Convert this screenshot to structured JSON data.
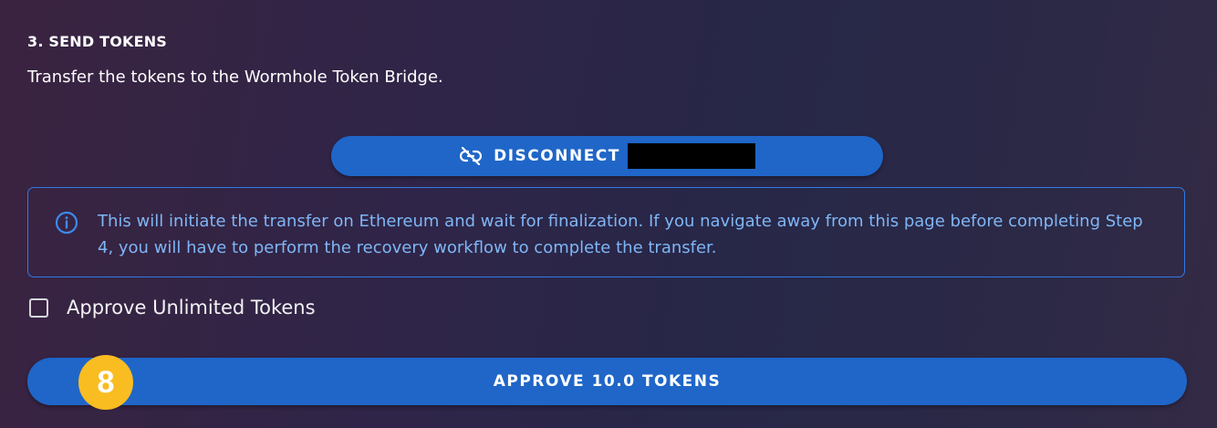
{
  "section": {
    "title": "3. SEND TOKENS",
    "description": "Transfer the tokens to the Wormhole Token Bridge."
  },
  "disconnect_button": {
    "label": "DISCONNECT",
    "icon": "link-off-icon"
  },
  "info_alert": {
    "icon": "info-icon",
    "text": "This will initiate the transfer on Ethereum and wait for finalization. If you navigate away from this page before completing Step 4, you will have to perform the recovery workflow to complete the transfer."
  },
  "unlimited_checkbox": {
    "label": "Approve Unlimited Tokens",
    "checked": false
  },
  "approve_button": {
    "label": "APPROVE 10.0 TOKENS"
  },
  "step_badge": {
    "number": "8"
  },
  "colors": {
    "button": "#1f66c8",
    "info_border": "#2f7ae5",
    "info_text": "#7fb6f5",
    "badge": "#f9bd22"
  }
}
